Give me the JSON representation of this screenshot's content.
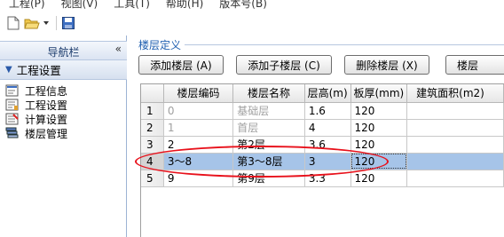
{
  "menu": [
    "工程(P)",
    "视图(V)",
    "工具(T)",
    "帮助(H)",
    "版本号(B)"
  ],
  "toolbar_icons": [
    "new-file-icon",
    "open-folder-icon",
    "dropdown-arrow-icon",
    "save-disk-icon"
  ],
  "nav": {
    "title": "导航栏",
    "collapse_glyph": "«",
    "section": "工程设置",
    "items": [
      {
        "label": "工程信息",
        "icon": "info-page-icon"
      },
      {
        "label": "工程设置",
        "icon": "settings-page-icon"
      },
      {
        "label": "计算设置",
        "icon": "calc-page-icon"
      },
      {
        "label": "楼层管理",
        "icon": "floor-stack-icon"
      }
    ]
  },
  "floor_def": {
    "title": "楼层定义",
    "buttons": {
      "add_floor": "添加楼层 (A)",
      "add_subfloor": "添加子楼层 (C)",
      "delete_floor": "删除楼层 (X)",
      "more": "楼层"
    }
  },
  "table": {
    "headers": [
      "",
      "楼层编码",
      "楼层名称",
      "层高(m)",
      "板厚(mm)",
      "建筑面积(m2)"
    ],
    "rows": [
      {
        "num": "1",
        "code": "0",
        "name": "基础层",
        "height": "1.6",
        "thickness": "120",
        "area": "",
        "gray": true
      },
      {
        "num": "2",
        "code": "1",
        "name": "首层",
        "height": "4",
        "thickness": "120",
        "area": "",
        "gray": true
      },
      {
        "num": "3",
        "code": "2",
        "name": "第2层",
        "height": "3.6",
        "thickness": "120",
        "area": "",
        "gray": false
      },
      {
        "num": "4",
        "code": "3～8",
        "name": "第3～8层",
        "height": "3",
        "thickness": "120",
        "area": "",
        "gray": false,
        "selected": true
      },
      {
        "num": "5",
        "code": "9",
        "name": "第9层",
        "height": "3.3",
        "thickness": "120",
        "area": "",
        "gray": false
      }
    ]
  },
  "colors": {
    "selection": "#a6c4e8",
    "annotation": "#e8111b",
    "nav_title": "#1a3a6b",
    "group_title": "#1f5fb0"
  }
}
